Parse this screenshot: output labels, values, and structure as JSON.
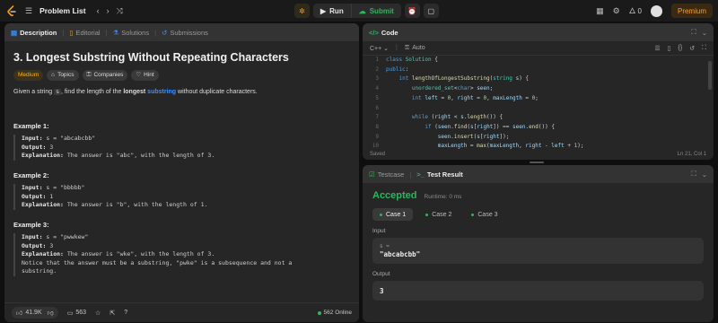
{
  "topbar": {
    "title": "Problem List",
    "run": "Run",
    "submit": "Submit",
    "streak": "0",
    "premium": "Premium"
  },
  "left": {
    "tabs": [
      "Description",
      "Editorial",
      "Solutions",
      "Submissions"
    ],
    "problem_title": "3. Longest Substring Without Repeating Characters",
    "chips": [
      "Medium",
      "Topics",
      "Companies",
      "Hint"
    ],
    "statement": {
      "p1": "Given a string ",
      "code": "s",
      "p2": ", find the length of the ",
      "b1": "longest",
      "kw": "substring",
      "p3": " without duplicate characters."
    },
    "examples": [
      {
        "title": "Example 1:",
        "input_label": "Input:",
        "input": " s = \"abcabcbb\"",
        "output_label": "Output:",
        "output": " 3",
        "expl_label": "Explanation:",
        "expl": " The answer is \"abc\", with the length of 3."
      },
      {
        "title": "Example 2:",
        "input_label": "Input:",
        "input": " s = \"bbbbb\"",
        "output_label": "Output:",
        "output": " 1",
        "expl_label": "Explanation:",
        "expl": " The answer is \"b\", with the length of 1."
      },
      {
        "title": "Example 3:",
        "input_label": "Input:",
        "input": " s = \"pwwkew\"",
        "output_label": "Output:",
        "output": " 3",
        "expl_label": "Explanation:",
        "expl": " The answer is \"wke\", with the length of 3.",
        "note1": "Notice that the answer must be a substring, \"pwke\" is a subsequence and not a",
        "note2": "substring."
      }
    ],
    "footer": {
      "likes": "41.9K",
      "comments": "563",
      "online": "562 Online"
    }
  },
  "code": {
    "tab": "Code",
    "lang": "C++",
    "auto": "Auto",
    "lines": [
      {
        "n": "1",
        "t": "class Solution {"
      },
      {
        "n": "2",
        "t": "public:"
      },
      {
        "n": "3",
        "t": "    int lengthOfLongestSubstring(string s) {"
      },
      {
        "n": "4",
        "t": "        unordered_set<char> seen;"
      },
      {
        "n": "5",
        "t": "        int left = 0, right = 0, maxLength = 0;"
      },
      {
        "n": "6",
        "t": ""
      },
      {
        "n": "7",
        "t": "        while (right < s.length()) {"
      },
      {
        "n": "8",
        "t": "            if (seen.find(s[right]) == seen.end()) {"
      },
      {
        "n": "9",
        "t": "                seen.insert(s[right]);"
      },
      {
        "n": "10",
        "t": "                maxLength = max(maxLength, right - left + 1);"
      }
    ],
    "saved": "Saved",
    "cursor": "Ln 21, Col 1"
  },
  "result": {
    "tabs": [
      "Testcase",
      "Test Result"
    ],
    "status": "Accepted",
    "runtime": "Runtime: 0 ms",
    "cases": [
      "Case 1",
      "Case 2",
      "Case 3"
    ],
    "input_label": "Input",
    "input_var": "s =",
    "input_val": "\"abcabcbb\"",
    "output_label": "Output",
    "output_val": "3"
  },
  "colors": {
    "accent_green": "#2db55d",
    "accent_orange": "#ffa116",
    "medium": "#ffb800",
    "link_blue": "#3b8fff"
  }
}
